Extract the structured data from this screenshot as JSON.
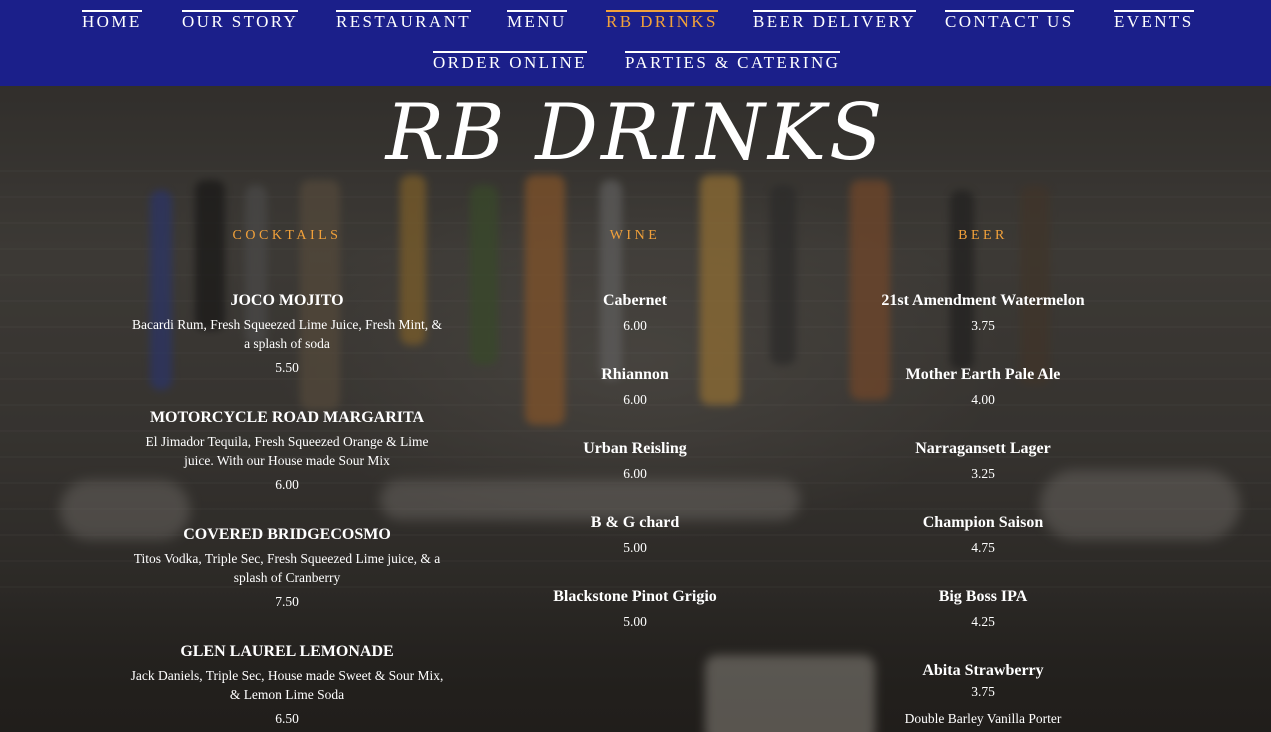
{
  "nav": {
    "items": [
      {
        "label": "HOME"
      },
      {
        "label": "OUR STORY"
      },
      {
        "label": "RESTAURANT"
      },
      {
        "label": "MENU"
      },
      {
        "label": "RB DRINKS"
      },
      {
        "label": "BEER DELIVERY"
      },
      {
        "label": "CONTACT US"
      },
      {
        "label": "EVENTS"
      },
      {
        "label": "ORDER ONLINE"
      },
      {
        "label": "PARTIES & CATERING"
      }
    ],
    "active": "RB DRINKS",
    "colors": {
      "bar": "#1b1f8a",
      "text": "#ffffff",
      "active": "#f2a13a"
    }
  },
  "page": {
    "title": "RB DRINKS"
  },
  "cocktails": {
    "heading": "COCKTAILS",
    "items": [
      {
        "name": "JOCO MOJITO",
        "desc": "Bacardi Rum, Fresh Squeezed Lime Juice, Fresh Mint, & a splash of soda",
        "price": "5.50"
      },
      {
        "name": "MOTORCYCLE ROAD MARGARITA",
        "desc": "El Jimador Tequila, Fresh Squeezed Orange & Lime juice. With our House made Sour Mix",
        "price": "6.00"
      },
      {
        "name": "COVERED BRIDGECOSMO",
        "desc": "Titos Vodka, Triple Sec, Fresh Squeezed Lime juice, & a splash of Cranberry",
        "price": "7.50"
      },
      {
        "name": "GLEN LAUREL LEMONADE",
        "desc": "Jack Daniels, Triple Sec, House made Sweet & Sour Mix, & Lemon Lime Soda",
        "price": "6.50"
      }
    ]
  },
  "wine": {
    "heading": "WINE",
    "items": [
      {
        "name": "Cabernet",
        "price": "6.00"
      },
      {
        "name": "Rhiannon",
        "price": "6.00"
      },
      {
        "name": "Urban Reisling",
        "price": "6.00"
      },
      {
        "name": "B & G chard",
        "price": "5.00"
      },
      {
        "name": "Blackstone Pinot Grigio",
        "price": "5.00"
      }
    ]
  },
  "beer": {
    "heading": "BEER",
    "items": [
      {
        "name": "21st Amendment Watermelon",
        "price": "3.75"
      },
      {
        "name": "Mother Earth Pale Ale",
        "price": "4.00"
      },
      {
        "name": "Narragansett Lager",
        "price": "3.25"
      },
      {
        "name": "Champion Saison",
        "price": "4.75"
      },
      {
        "name": "Big Boss IPA",
        "price": "4.25"
      },
      {
        "name": "Abita Strawberry",
        "price": "3.75"
      }
    ],
    "next_item": "Double Barley Vanilla Porter"
  }
}
